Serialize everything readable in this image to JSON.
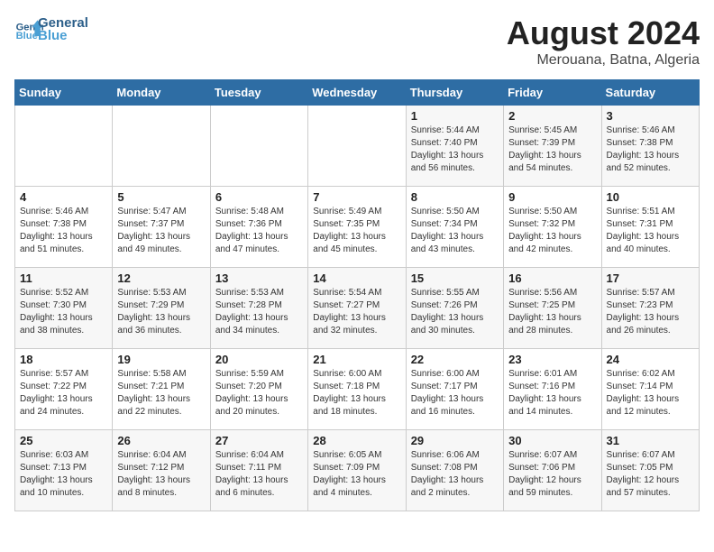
{
  "logo": {
    "line1": "General",
    "line2": "Blue"
  },
  "title": {
    "month_year": "August 2024",
    "location": "Merouana, Batna, Algeria"
  },
  "weekdays": [
    "Sunday",
    "Monday",
    "Tuesday",
    "Wednesday",
    "Thursday",
    "Friday",
    "Saturday"
  ],
  "weeks": [
    [
      {
        "day": "",
        "info": ""
      },
      {
        "day": "",
        "info": ""
      },
      {
        "day": "",
        "info": ""
      },
      {
        "day": "",
        "info": ""
      },
      {
        "day": "1",
        "info": "Sunrise: 5:44 AM\nSunset: 7:40 PM\nDaylight: 13 hours\nand 56 minutes."
      },
      {
        "day": "2",
        "info": "Sunrise: 5:45 AM\nSunset: 7:39 PM\nDaylight: 13 hours\nand 54 minutes."
      },
      {
        "day": "3",
        "info": "Sunrise: 5:46 AM\nSunset: 7:38 PM\nDaylight: 13 hours\nand 52 minutes."
      }
    ],
    [
      {
        "day": "4",
        "info": "Sunrise: 5:46 AM\nSunset: 7:38 PM\nDaylight: 13 hours\nand 51 minutes."
      },
      {
        "day": "5",
        "info": "Sunrise: 5:47 AM\nSunset: 7:37 PM\nDaylight: 13 hours\nand 49 minutes."
      },
      {
        "day": "6",
        "info": "Sunrise: 5:48 AM\nSunset: 7:36 PM\nDaylight: 13 hours\nand 47 minutes."
      },
      {
        "day": "7",
        "info": "Sunrise: 5:49 AM\nSunset: 7:35 PM\nDaylight: 13 hours\nand 45 minutes."
      },
      {
        "day": "8",
        "info": "Sunrise: 5:50 AM\nSunset: 7:34 PM\nDaylight: 13 hours\nand 43 minutes."
      },
      {
        "day": "9",
        "info": "Sunrise: 5:50 AM\nSunset: 7:32 PM\nDaylight: 13 hours\nand 42 minutes."
      },
      {
        "day": "10",
        "info": "Sunrise: 5:51 AM\nSunset: 7:31 PM\nDaylight: 13 hours\nand 40 minutes."
      }
    ],
    [
      {
        "day": "11",
        "info": "Sunrise: 5:52 AM\nSunset: 7:30 PM\nDaylight: 13 hours\nand 38 minutes."
      },
      {
        "day": "12",
        "info": "Sunrise: 5:53 AM\nSunset: 7:29 PM\nDaylight: 13 hours\nand 36 minutes."
      },
      {
        "day": "13",
        "info": "Sunrise: 5:53 AM\nSunset: 7:28 PM\nDaylight: 13 hours\nand 34 minutes."
      },
      {
        "day": "14",
        "info": "Sunrise: 5:54 AM\nSunset: 7:27 PM\nDaylight: 13 hours\nand 32 minutes."
      },
      {
        "day": "15",
        "info": "Sunrise: 5:55 AM\nSunset: 7:26 PM\nDaylight: 13 hours\nand 30 minutes."
      },
      {
        "day": "16",
        "info": "Sunrise: 5:56 AM\nSunset: 7:25 PM\nDaylight: 13 hours\nand 28 minutes."
      },
      {
        "day": "17",
        "info": "Sunrise: 5:57 AM\nSunset: 7:23 PM\nDaylight: 13 hours\nand 26 minutes."
      }
    ],
    [
      {
        "day": "18",
        "info": "Sunrise: 5:57 AM\nSunset: 7:22 PM\nDaylight: 13 hours\nand 24 minutes."
      },
      {
        "day": "19",
        "info": "Sunrise: 5:58 AM\nSunset: 7:21 PM\nDaylight: 13 hours\nand 22 minutes."
      },
      {
        "day": "20",
        "info": "Sunrise: 5:59 AM\nSunset: 7:20 PM\nDaylight: 13 hours\nand 20 minutes."
      },
      {
        "day": "21",
        "info": "Sunrise: 6:00 AM\nSunset: 7:18 PM\nDaylight: 13 hours\nand 18 minutes."
      },
      {
        "day": "22",
        "info": "Sunrise: 6:00 AM\nSunset: 7:17 PM\nDaylight: 13 hours\nand 16 minutes."
      },
      {
        "day": "23",
        "info": "Sunrise: 6:01 AM\nSunset: 7:16 PM\nDaylight: 13 hours\nand 14 minutes."
      },
      {
        "day": "24",
        "info": "Sunrise: 6:02 AM\nSunset: 7:14 PM\nDaylight: 13 hours\nand 12 minutes."
      }
    ],
    [
      {
        "day": "25",
        "info": "Sunrise: 6:03 AM\nSunset: 7:13 PM\nDaylight: 13 hours\nand 10 minutes."
      },
      {
        "day": "26",
        "info": "Sunrise: 6:04 AM\nSunset: 7:12 PM\nDaylight: 13 hours\nand 8 minutes."
      },
      {
        "day": "27",
        "info": "Sunrise: 6:04 AM\nSunset: 7:11 PM\nDaylight: 13 hours\nand 6 minutes."
      },
      {
        "day": "28",
        "info": "Sunrise: 6:05 AM\nSunset: 7:09 PM\nDaylight: 13 hours\nand 4 minutes."
      },
      {
        "day": "29",
        "info": "Sunrise: 6:06 AM\nSunset: 7:08 PM\nDaylight: 13 hours\nand 2 minutes."
      },
      {
        "day": "30",
        "info": "Sunrise: 6:07 AM\nSunset: 7:06 PM\nDaylight: 12 hours\nand 59 minutes."
      },
      {
        "day": "31",
        "info": "Sunrise: 6:07 AM\nSunset: 7:05 PM\nDaylight: 12 hours\nand 57 minutes."
      }
    ]
  ]
}
